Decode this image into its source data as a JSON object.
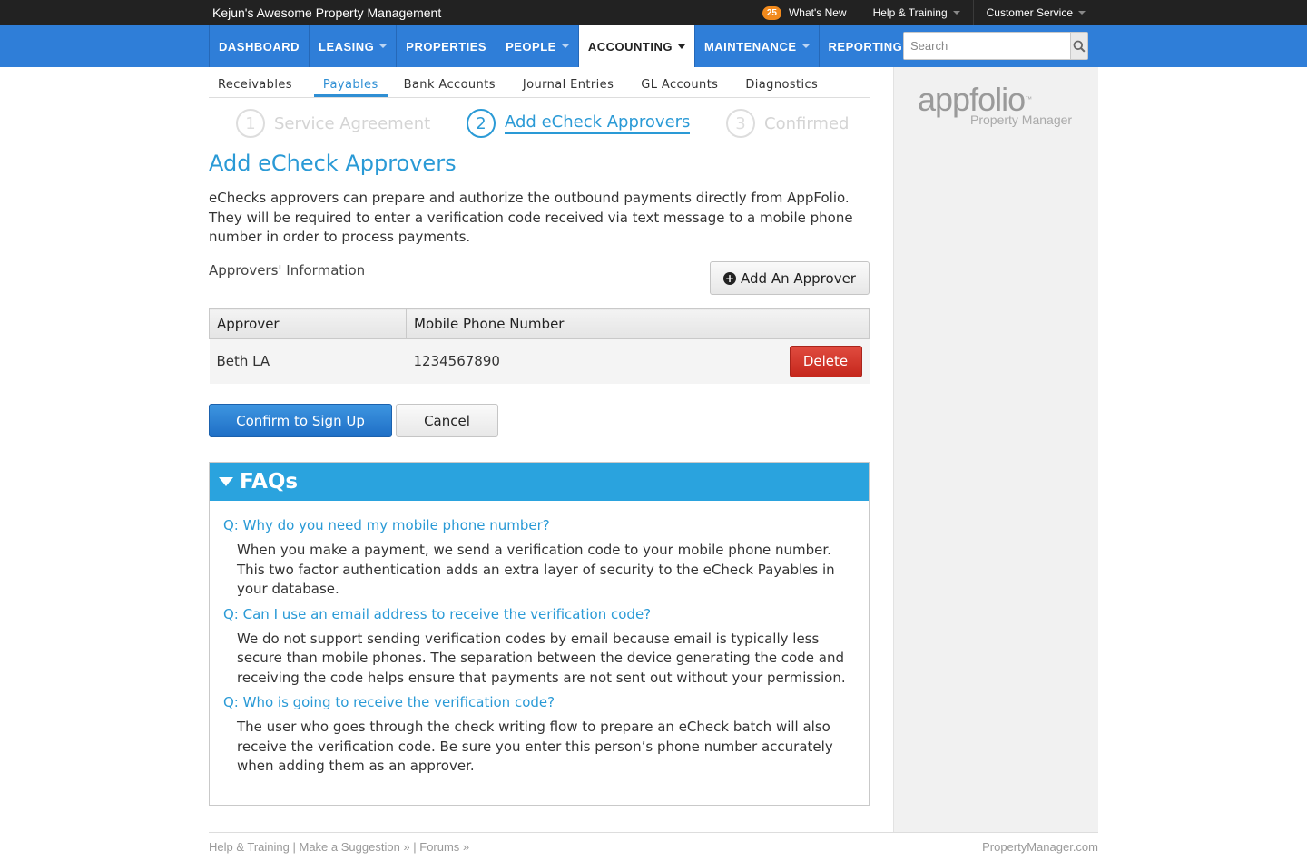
{
  "topbar": {
    "brand": "Kejun's Awesome Property Management",
    "whats_new_count": "25",
    "whats_new": "What's New",
    "help_training": "Help & Training",
    "customer_service": "Customer Service"
  },
  "nav": {
    "items": [
      {
        "label": "DASHBOARD"
      },
      {
        "label": "LEASING"
      },
      {
        "label": "PROPERTIES"
      },
      {
        "label": "PEOPLE"
      },
      {
        "label": "ACCOUNTING"
      },
      {
        "label": "MAINTENANCE"
      },
      {
        "label": "REPORTING"
      }
    ],
    "search_placeholder": "Search"
  },
  "subtabs": [
    "Receivables",
    "Payables",
    "Bank Accounts",
    "Journal Entries",
    "GL Accounts",
    "Diagnostics"
  ],
  "steps": [
    {
      "num": "1",
      "label": "Service Agreement"
    },
    {
      "num": "2",
      "label": "Add eCheck Approvers"
    },
    {
      "num": "3",
      "label": "Confirmed"
    }
  ],
  "page": {
    "title": "Add eCheck Approvers",
    "intro": "eChecks approvers can prepare and authorize the outbound payments directly from AppFolio. They will be required to enter a verification code received via text message to a mobile phone number in order to process payments.",
    "approvers_label": "Approvers' Information",
    "add_button": "Add An Approver",
    "table": {
      "headers": [
        "Approver",
        "Mobile Phone Number"
      ],
      "rows": [
        {
          "approver": "Beth LA",
          "phone": "1234567890",
          "action": "Delete"
        }
      ]
    },
    "confirm_button": "Confirm to Sign Up",
    "cancel_button": "Cancel"
  },
  "faq": {
    "title": "FAQs",
    "items": [
      {
        "q": "Q: Why do you need my mobile phone number?",
        "a": "When you make a payment, we send a verification code to your mobile phone number. This two factor authentication adds an extra layer of security to the eCheck Payables in your database."
      },
      {
        "q": "Q: Can I use an email address to receive the verification code?",
        "a": "We do not support sending verification codes by email because email is typically less secure than mobile phones. The separation between the device generating the code and receiving the code helps ensure that payments are not sent out without your permission."
      },
      {
        "q": "Q: Who is going to receive the verification code?",
        "a": "The user who goes through the check writing flow to prepare an eCheck batch will also receive the verification code. Be sure you enter this person’s phone number accurately when adding them as an approver."
      }
    ]
  },
  "sidebar": {
    "logo_text": "appfolio",
    "logo_tm": "™",
    "logo_sub": "Property Manager"
  },
  "footer": {
    "help": "Help & Training",
    "sep1": " | ",
    "suggestion": "Make a Suggestion »",
    "sep2": " | ",
    "forums": "Forums »",
    "site": "PropertyManager.com"
  },
  "colors": {
    "nav_blue": "#2f7ed8",
    "accent": "#2a9ad6",
    "faq_header": "#2aa3de",
    "delete_red": "#d2372c",
    "badge_orange": "#f28a1c"
  }
}
